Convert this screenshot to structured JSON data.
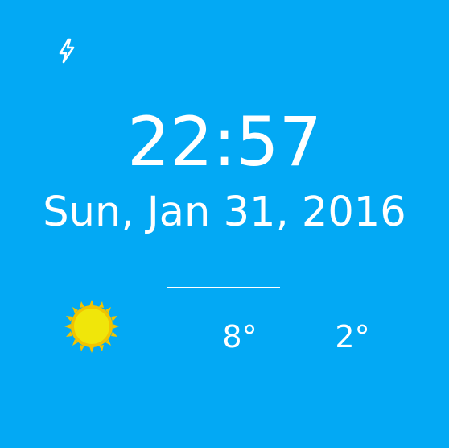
{
  "status": {
    "charging_icon": "lightning-bolt-icon"
  },
  "clock": {
    "time": "22:57",
    "date": "Sun, Jan 31, 2016"
  },
  "weather": {
    "condition_icon": "sun-icon",
    "high_temp": "8°",
    "low_temp": "2°"
  },
  "colors": {
    "background": "#03A9F4",
    "text": "#FFFFFF",
    "sun_fill": "#F0E60A",
    "sun_rays": "#F2C400"
  }
}
